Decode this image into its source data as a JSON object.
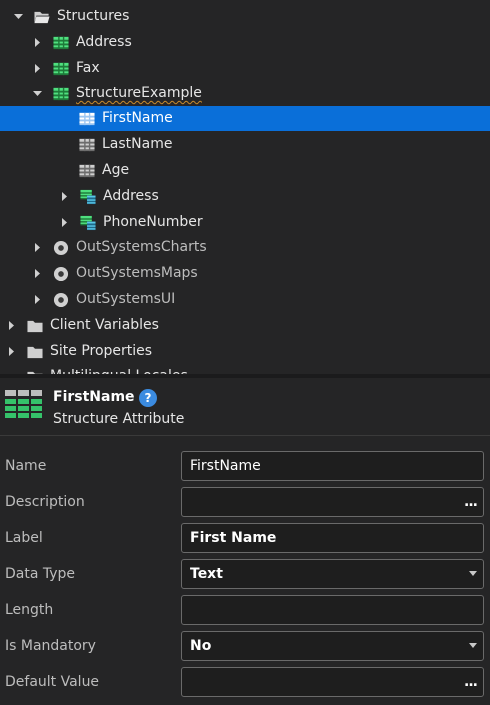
{
  "tree": {
    "items": [
      {
        "label": "Structures",
        "icon": "folder-open-icon",
        "arrow": "expanded"
      },
      {
        "label": "Address",
        "icon": "structure-icon",
        "arrow": "collapsed"
      },
      {
        "label": "Fax",
        "icon": "structure-icon",
        "arrow": "collapsed"
      },
      {
        "label": "StructureExample",
        "icon": "structure-icon",
        "arrow": "expanded"
      },
      {
        "label": "FirstName",
        "icon": "attribute-icon",
        "arrow": "none",
        "selected": true
      },
      {
        "label": "LastName",
        "icon": "attribute-icon",
        "arrow": "none"
      },
      {
        "label": "Age",
        "icon": "attribute-icon",
        "arrow": "none"
      },
      {
        "label": "Address",
        "icon": "structure-attribute-icon",
        "arrow": "collapsed"
      },
      {
        "label": "PhoneNumber",
        "icon": "structure-attribute-icon",
        "arrow": "collapsed"
      },
      {
        "label": "OutSystemsCharts",
        "icon": "module-icon",
        "arrow": "collapsed"
      },
      {
        "label": "OutSystemsMaps",
        "icon": "module-icon",
        "arrow": "collapsed"
      },
      {
        "label": "OutSystemsUI",
        "icon": "module-icon",
        "arrow": "collapsed"
      },
      {
        "label": "Client Variables",
        "icon": "folder-icon",
        "arrow": "collapsed"
      },
      {
        "label": "Site Properties",
        "icon": "folder-icon",
        "arrow": "collapsed"
      },
      {
        "label": "Multilingual Locales",
        "icon": "folder-icon",
        "arrow": "none"
      }
    ]
  },
  "properties": {
    "title": "FirstName",
    "help_label": "?",
    "subtitle": "Structure Attribute",
    "fields": [
      {
        "label": "Name",
        "value": "FirstName",
        "kind": "text"
      },
      {
        "label": "Description",
        "value": "",
        "kind": "ellipsis",
        "button": "..."
      },
      {
        "label": "Label",
        "value": "First Name",
        "kind": "text"
      },
      {
        "label": "Data Type",
        "value": "Text",
        "kind": "dropdown"
      },
      {
        "label": "Length",
        "value": "",
        "kind": "text"
      },
      {
        "label": "Is Mandatory",
        "value": "No",
        "kind": "dropdown"
      },
      {
        "label": "Default Value",
        "value": "",
        "kind": "ellipsis",
        "button": "..."
      }
    ]
  },
  "colors": {
    "background": "#252526",
    "selection": "#0a6fd9",
    "structure_green": "#35c26a",
    "attribute_gray": "#9e9e9e"
  }
}
